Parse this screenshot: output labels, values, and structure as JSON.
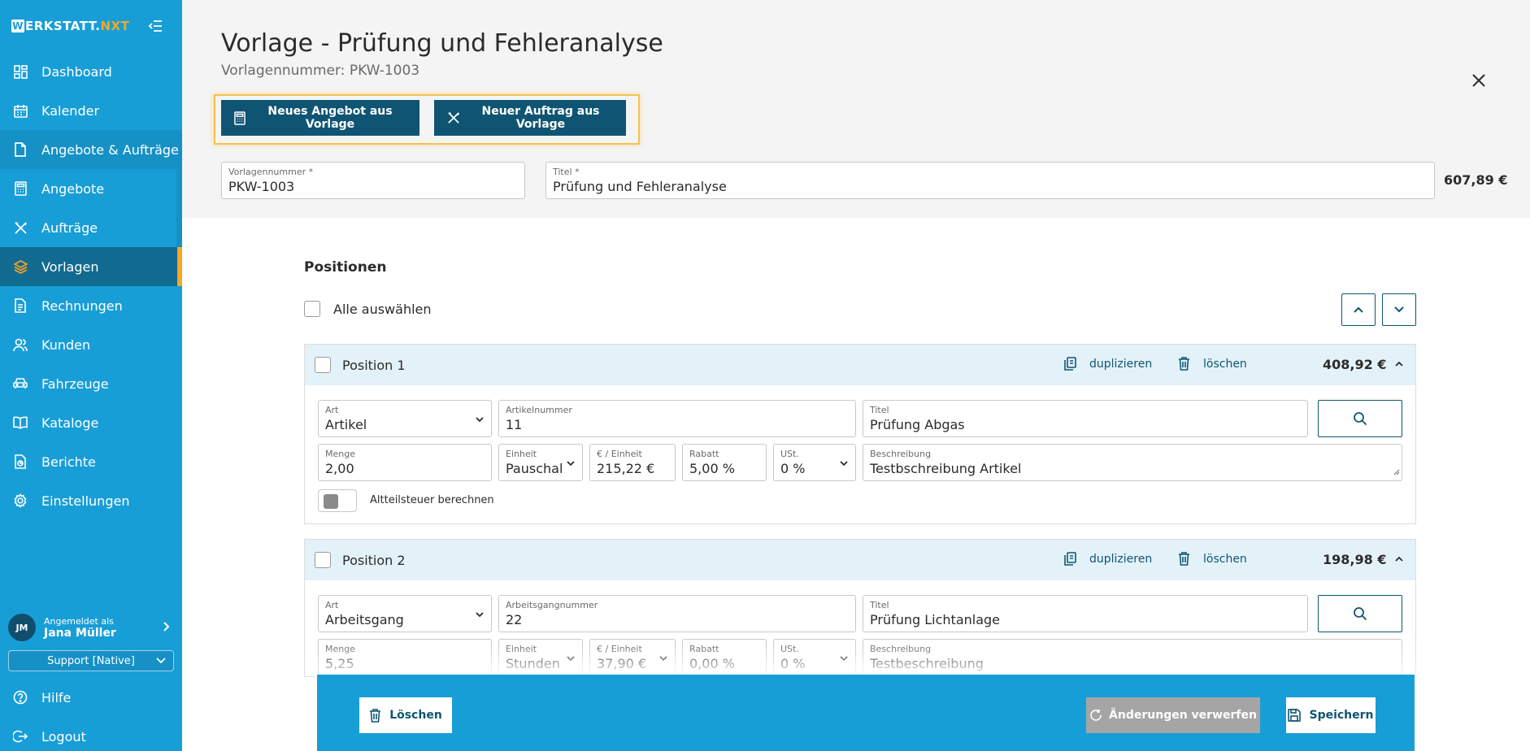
{
  "app": {
    "logo": {
      "w": "W",
      "rest": "ERKSTATT.",
      "nxt": "NXT"
    }
  },
  "sidebar": {
    "items": [
      {
        "label": "Dashboard",
        "icon": "dashboard-icon"
      },
      {
        "label": "Kalender",
        "icon": "calendar-icon"
      },
      {
        "label": "Angebote & Aufträge",
        "icon": "document-icon"
      },
      {
        "label": "Angebote",
        "icon": "calculator-icon"
      },
      {
        "label": "Aufträge",
        "icon": "tools-icon"
      },
      {
        "label": "Vorlagen",
        "icon": "layers-icon"
      },
      {
        "label": "Rechnungen",
        "icon": "invoice-icon"
      },
      {
        "label": "Kunden",
        "icon": "users-icon"
      },
      {
        "label": "Fahrzeuge",
        "icon": "car-icon"
      },
      {
        "label": "Kataloge",
        "icon": "book-icon"
      },
      {
        "label": "Berichte",
        "icon": "report-icon"
      },
      {
        "label": "Einstellungen",
        "icon": "gear-icon"
      }
    ],
    "user": {
      "initials": "JM",
      "logged_in_as": "Angemeldet als",
      "name": "Jana Müller",
      "support_select": "Support [Native]"
    },
    "bottom": [
      {
        "label": "Hilfe",
        "icon": "help-icon"
      },
      {
        "label": "Logout",
        "icon": "logout-icon"
      }
    ]
  },
  "header": {
    "title": "Vorlage - Prüfung und Fehleranalyse",
    "subtitle": "Vorlagennummer: PKW-1003",
    "actions": {
      "new_offer": "Neues Angebot aus Vorlage",
      "new_order": "Neuer Auftrag aus Vorlage"
    },
    "fields": {
      "template_number": {
        "label": "Vorlagennummer *",
        "value": "PKW-1003"
      },
      "title": {
        "label": "Titel *",
        "value": "Prüfung und Fehleranalyse"
      }
    },
    "total": "607,89 €"
  },
  "positions": {
    "section_title": "Positionen",
    "select_all": "Alle auswählen",
    "duplicate_label": "duplizieren",
    "delete_label": "löschen",
    "items": [
      {
        "name": "Position 1",
        "price": "408,92 €",
        "art": {
          "label": "Art",
          "value": "Artikel"
        },
        "number": {
          "label": "Artikelnummer",
          "value": "11"
        },
        "title": {
          "label": "Titel",
          "value": "Prüfung Abgas"
        },
        "menge": {
          "label": "Menge",
          "value": "2,00"
        },
        "einheit": {
          "label": "Einheit",
          "value": "Pauschal"
        },
        "preis": {
          "label": "€ / Einheit",
          "value": "215,22 €"
        },
        "rabatt": {
          "label": "Rabatt",
          "value": "5,00 %"
        },
        "ust": {
          "label": "USt.",
          "value": "0 %"
        },
        "beschreibung": {
          "label": "Beschreibung",
          "value": "Testbschreibung Artikel"
        },
        "toggle_label": "Altteilsteuer berechnen"
      },
      {
        "name": "Position 2",
        "price": "198,98 €",
        "art": {
          "label": "Art",
          "value": "Arbeitsgang"
        },
        "number": {
          "label": "Arbeitsgangnummer",
          "value": "22"
        },
        "title": {
          "label": "Titel",
          "value": "Prüfung Lichtanlage"
        },
        "menge": {
          "label": "Menge",
          "value": "5,25"
        },
        "einheit": {
          "label": "Einheit",
          "value": "Stunden"
        },
        "preis": {
          "label": "€ / Einheit",
          "value": "37,90 €"
        },
        "rabatt": {
          "label": "Rabatt",
          "value": "0,00 %"
        },
        "ust": {
          "label": "USt.",
          "value": "0 %"
        },
        "beschreibung": {
          "label": "Beschreibung",
          "value": "Testbeschreibung"
        }
      }
    ]
  },
  "footer": {
    "delete": "Löschen",
    "discard": "Änderungen verwerfen",
    "save": "Speichern"
  },
  "colors": {
    "sidebar": "#189ed6",
    "active": "#116a8f",
    "accent": "#f6a623",
    "button_dark": "#0f5573"
  }
}
